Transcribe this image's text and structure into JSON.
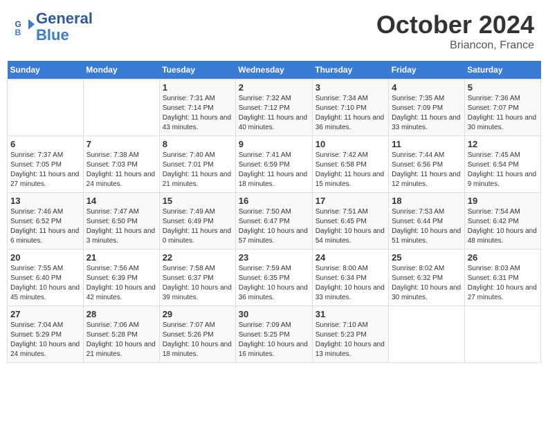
{
  "header": {
    "logo_line1": "General",
    "logo_line2": "Blue",
    "month": "October 2024",
    "location": "Briancon, France"
  },
  "days_of_week": [
    "Sunday",
    "Monday",
    "Tuesday",
    "Wednesday",
    "Thursday",
    "Friday",
    "Saturday"
  ],
  "weeks": [
    [
      {
        "day": "",
        "info": ""
      },
      {
        "day": "",
        "info": ""
      },
      {
        "day": "1",
        "info": "Sunrise: 7:31 AM\nSunset: 7:14 PM\nDaylight: 11 hours and 43 minutes."
      },
      {
        "day": "2",
        "info": "Sunrise: 7:32 AM\nSunset: 7:12 PM\nDaylight: 11 hours and 40 minutes."
      },
      {
        "day": "3",
        "info": "Sunrise: 7:34 AM\nSunset: 7:10 PM\nDaylight: 11 hours and 36 minutes."
      },
      {
        "day": "4",
        "info": "Sunrise: 7:35 AM\nSunset: 7:09 PM\nDaylight: 11 hours and 33 minutes."
      },
      {
        "day": "5",
        "info": "Sunrise: 7:36 AM\nSunset: 7:07 PM\nDaylight: 11 hours and 30 minutes."
      }
    ],
    [
      {
        "day": "6",
        "info": "Sunrise: 7:37 AM\nSunset: 7:05 PM\nDaylight: 11 hours and 27 minutes."
      },
      {
        "day": "7",
        "info": "Sunrise: 7:38 AM\nSunset: 7:03 PM\nDaylight: 11 hours and 24 minutes."
      },
      {
        "day": "8",
        "info": "Sunrise: 7:40 AM\nSunset: 7:01 PM\nDaylight: 11 hours and 21 minutes."
      },
      {
        "day": "9",
        "info": "Sunrise: 7:41 AM\nSunset: 6:59 PM\nDaylight: 11 hours and 18 minutes."
      },
      {
        "day": "10",
        "info": "Sunrise: 7:42 AM\nSunset: 6:58 PM\nDaylight: 11 hours and 15 minutes."
      },
      {
        "day": "11",
        "info": "Sunrise: 7:44 AM\nSunset: 6:56 PM\nDaylight: 11 hours and 12 minutes."
      },
      {
        "day": "12",
        "info": "Sunrise: 7:45 AM\nSunset: 6:54 PM\nDaylight: 11 hours and 9 minutes."
      }
    ],
    [
      {
        "day": "13",
        "info": "Sunrise: 7:46 AM\nSunset: 6:52 PM\nDaylight: 11 hours and 6 minutes."
      },
      {
        "day": "14",
        "info": "Sunrise: 7:47 AM\nSunset: 6:50 PM\nDaylight: 11 hours and 3 minutes."
      },
      {
        "day": "15",
        "info": "Sunrise: 7:49 AM\nSunset: 6:49 PM\nDaylight: 11 hours and 0 minutes."
      },
      {
        "day": "16",
        "info": "Sunrise: 7:50 AM\nSunset: 6:47 PM\nDaylight: 10 hours and 57 minutes."
      },
      {
        "day": "17",
        "info": "Sunrise: 7:51 AM\nSunset: 6:45 PM\nDaylight: 10 hours and 54 minutes."
      },
      {
        "day": "18",
        "info": "Sunrise: 7:53 AM\nSunset: 6:44 PM\nDaylight: 10 hours and 51 minutes."
      },
      {
        "day": "19",
        "info": "Sunrise: 7:54 AM\nSunset: 6:42 PM\nDaylight: 10 hours and 48 minutes."
      }
    ],
    [
      {
        "day": "20",
        "info": "Sunrise: 7:55 AM\nSunset: 6:40 PM\nDaylight: 10 hours and 45 minutes."
      },
      {
        "day": "21",
        "info": "Sunrise: 7:56 AM\nSunset: 6:39 PM\nDaylight: 10 hours and 42 minutes."
      },
      {
        "day": "22",
        "info": "Sunrise: 7:58 AM\nSunset: 6:37 PM\nDaylight: 10 hours and 39 minutes."
      },
      {
        "day": "23",
        "info": "Sunrise: 7:59 AM\nSunset: 6:35 PM\nDaylight: 10 hours and 36 minutes."
      },
      {
        "day": "24",
        "info": "Sunrise: 8:00 AM\nSunset: 6:34 PM\nDaylight: 10 hours and 33 minutes."
      },
      {
        "day": "25",
        "info": "Sunrise: 8:02 AM\nSunset: 6:32 PM\nDaylight: 10 hours and 30 minutes."
      },
      {
        "day": "26",
        "info": "Sunrise: 8:03 AM\nSunset: 6:31 PM\nDaylight: 10 hours and 27 minutes."
      }
    ],
    [
      {
        "day": "27",
        "info": "Sunrise: 7:04 AM\nSunset: 5:29 PM\nDaylight: 10 hours and 24 minutes."
      },
      {
        "day": "28",
        "info": "Sunrise: 7:06 AM\nSunset: 5:28 PM\nDaylight: 10 hours and 21 minutes."
      },
      {
        "day": "29",
        "info": "Sunrise: 7:07 AM\nSunset: 5:26 PM\nDaylight: 10 hours and 18 minutes."
      },
      {
        "day": "30",
        "info": "Sunrise: 7:09 AM\nSunset: 5:25 PM\nDaylight: 10 hours and 16 minutes."
      },
      {
        "day": "31",
        "info": "Sunrise: 7:10 AM\nSunset: 5:23 PM\nDaylight: 10 hours and 13 minutes."
      },
      {
        "day": "",
        "info": ""
      },
      {
        "day": "",
        "info": ""
      }
    ]
  ]
}
